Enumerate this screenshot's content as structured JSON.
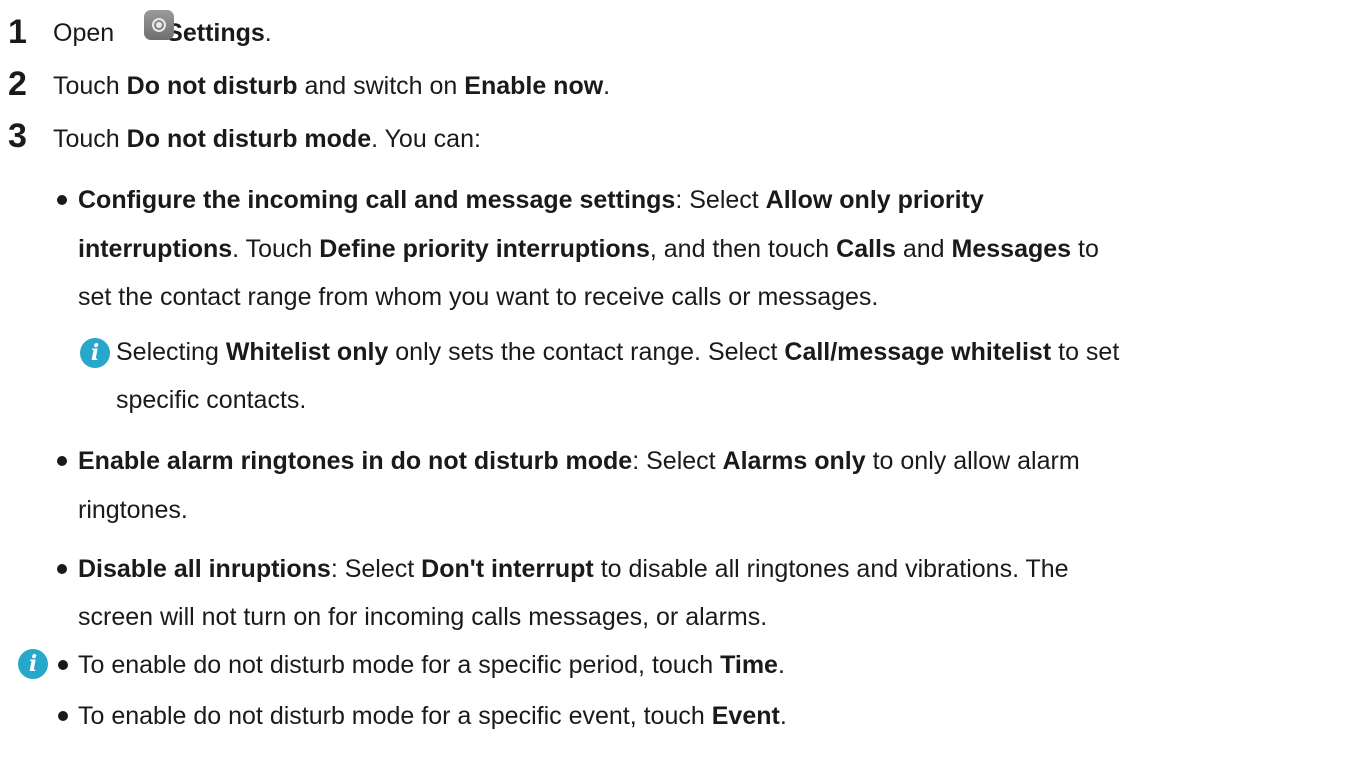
{
  "step1": {
    "num": "1",
    "open": "Open",
    "settings": "Settings",
    "end": "."
  },
  "step2": {
    "num": "2",
    "touch": "Touch",
    "dnd": "Do not disturb",
    "and": "and switch on",
    "enable": "Enable now",
    "end": "."
  },
  "step3": {
    "num": "3",
    "touch": "Touch",
    "dndmode": "Do not disturb mode",
    "rest": ". You can:"
  },
  "b1": {
    "l1_bold1": "Configure the incoming call and message settings",
    "l1_t1": ": Select",
    "l1_bold2": "Allow only priority",
    "l2_bold1": "interruptions",
    "l2_t1": ". Touch",
    "l2_bold2": "Define priority interruptions",
    "l2_t2": ", and then touch",
    "l2_bold3": "Calls",
    "l2_t3": "and",
    "l2_bold4": "Messages",
    "l2_t4": "to",
    "l3": "set the contact range from whom you want to receive calls or messages."
  },
  "note1": {
    "t1": "Selecting",
    "bold1": "Whitelist only",
    "t2": "only sets the contact range. Select",
    "bold2": "Call/message whitelist",
    "t3": "to set",
    "l2": "specific contacts."
  },
  "b2": {
    "bold1": "Enable alarm ringtones in do not disturb mode",
    "t1": ": Select",
    "bold2": "Alarms only",
    "t2": "to only allow alarm",
    "l2": "ringtones."
  },
  "b3": {
    "bold1": "Disable all inruptions",
    "t1": ": Select",
    "bold2": "Don't interrupt",
    "t2": "to disable all ringtones and vibrations. The",
    "l2": "screen will not turn on for incoming calls messages, or alarms."
  },
  "tips": {
    "t1": "To enable do not disturb mode for a specific period, touch",
    "bold1": "Time",
    "end1": ".",
    "t2": "To enable do not disturb mode for a specific event, touch",
    "bold2": "Event",
    "end2": "."
  },
  "icons": {
    "info_color": "#27a7c9",
    "info_glyph": "i"
  }
}
